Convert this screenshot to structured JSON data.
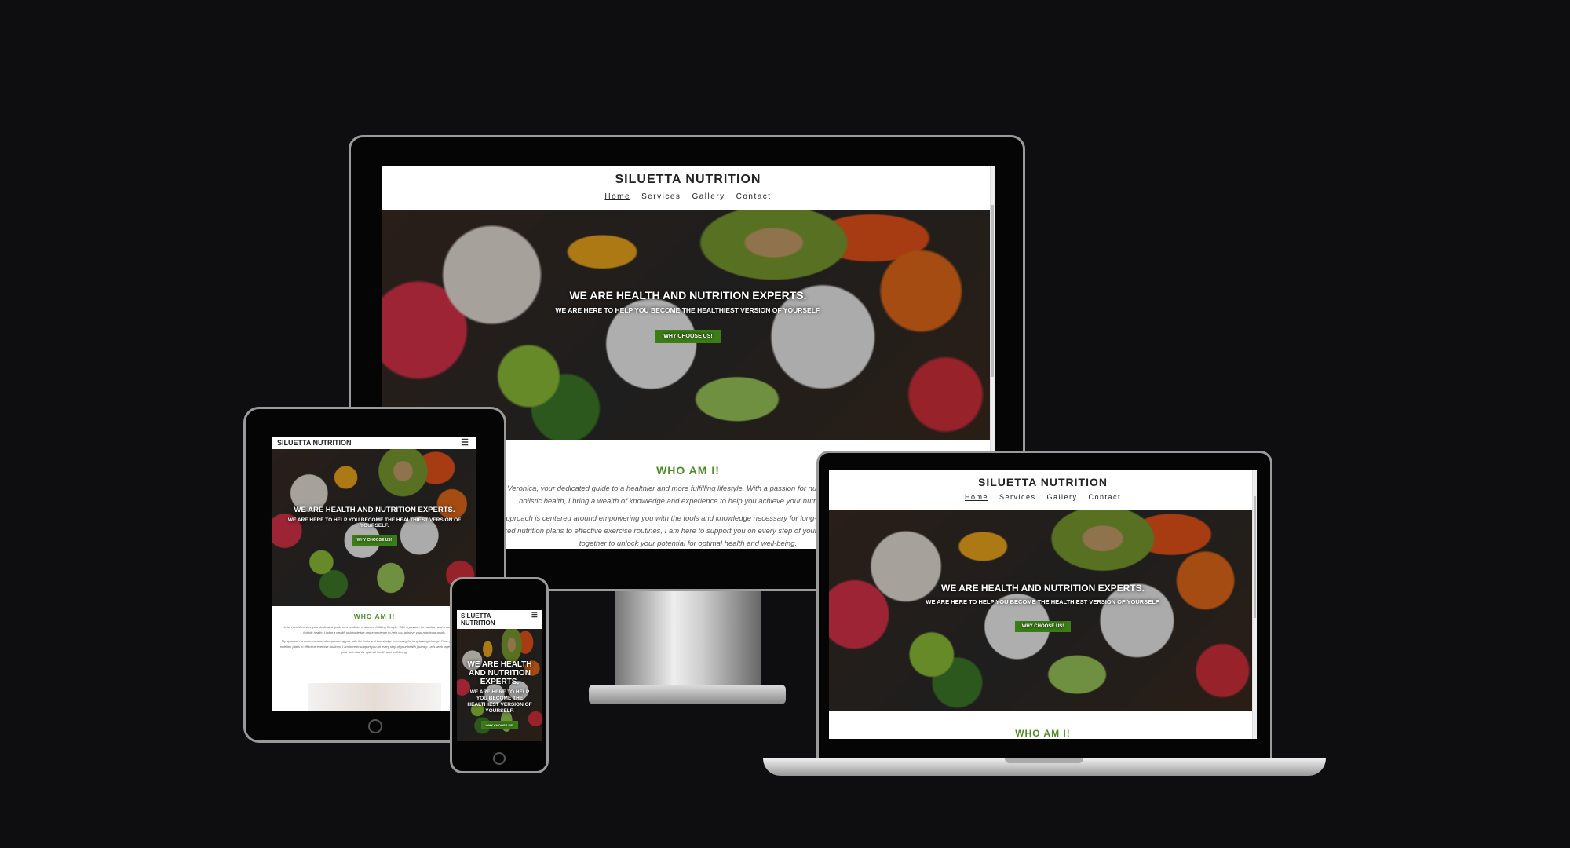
{
  "site": {
    "title": "SILUETTA NUTRITION",
    "title_mobile_line1": "SILUETTA",
    "title_mobile_line2": "NUTRITION",
    "nav": [
      "Home",
      "Services",
      "Gallery",
      "Contact"
    ],
    "active_nav": "Home",
    "hero_heading": "WE ARE HEALTH AND NUTRITION EXPERTS.",
    "hero_sub": "WE ARE HERE TO HELP YOU BECOME THE HEALTHIEST VERSION OF YOURSELF.",
    "cta": "WHY CHOOSE US!",
    "about_heading": "WHO AM I!",
    "about_p1": "Hello, I am Veronica, your dedicated guide to a healthier and more fulfilling lifestyle. With a passion for nutrition and a commitment to holistic health, I bring a wealth of knowledge and experience to help you achieve your nutritional goals.",
    "about_p2": "My approach is centered around empowering you with the tools and knowledge necessary for long-lasting change. From personalized nutrition plans to effective exercise routines, I am here to support you on every step of your health journey. Let's work together to unlock your potential for optimal health and well-being."
  },
  "colors": {
    "background": "#0e0d0f",
    "accent_green": "#3c7d17",
    "heading_green": "#4f8a2a"
  },
  "icons": {
    "menu": "hamburger-menu-icon"
  }
}
